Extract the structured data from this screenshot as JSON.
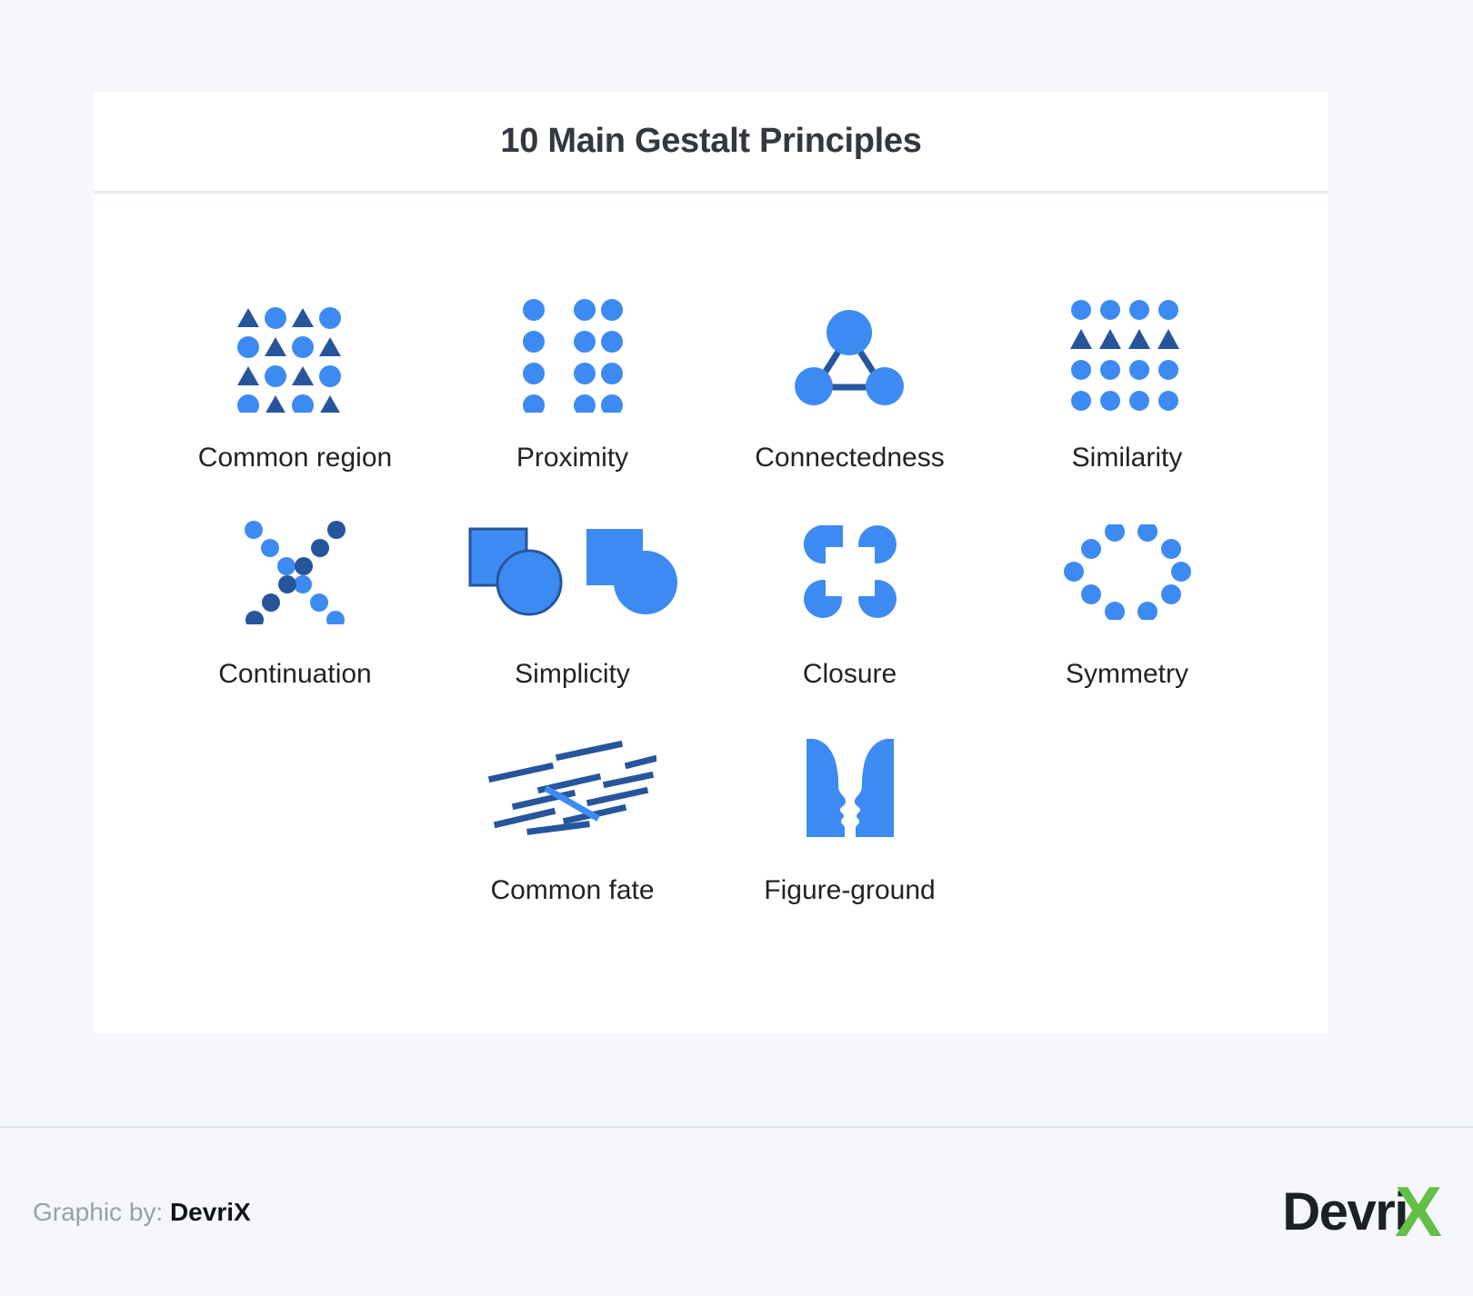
{
  "card": {
    "title": "10 Main Gestalt Principles"
  },
  "principles": [
    {
      "id": "common-region",
      "label": "Common region",
      "icon": "checkerboard-triangles-circles-grid-icon"
    },
    {
      "id": "proximity",
      "label": "Proximity",
      "icon": "grouped-dot-columns-icon"
    },
    {
      "id": "connectedness",
      "label": "Connectedness",
      "icon": "connected-triangle-nodes-icon"
    },
    {
      "id": "similarity",
      "label": "Similarity",
      "icon": "circle-grid-with-triangle-row-icon"
    },
    {
      "id": "continuation",
      "label": "Continuation",
      "icon": "crossing-dot-lines-icon"
    },
    {
      "id": "simplicity",
      "label": "Simplicity",
      "icon": "square-circle-merge-icon"
    },
    {
      "id": "closure",
      "label": "Closure",
      "icon": "four-quarter-shapes-implied-square-icon"
    },
    {
      "id": "symmetry",
      "label": "Symmetry",
      "icon": "symmetric-dot-ring-icon"
    },
    {
      "id": "common-fate",
      "label": "Common fate",
      "icon": "parallel-lines-one-diverging-icon"
    },
    {
      "id": "figure-ground",
      "label": "Figure-ground",
      "icon": "rubin-vase-faces-icon"
    }
  ],
  "footer": {
    "credit_prefix": "Graphic by:",
    "credit_brand": "DevriX",
    "logo_text": "Devri",
    "logo_accent": "X"
  },
  "colors": {
    "light_blue": "#3d8bf2",
    "dark_blue": "#27559c",
    "page_background": "#f5f7fa",
    "card_background": "#ffffff",
    "title_text": "#33383f",
    "label_text": "#1f2326",
    "logo_green": "#63bf45",
    "divider": "#e4e8f2"
  }
}
